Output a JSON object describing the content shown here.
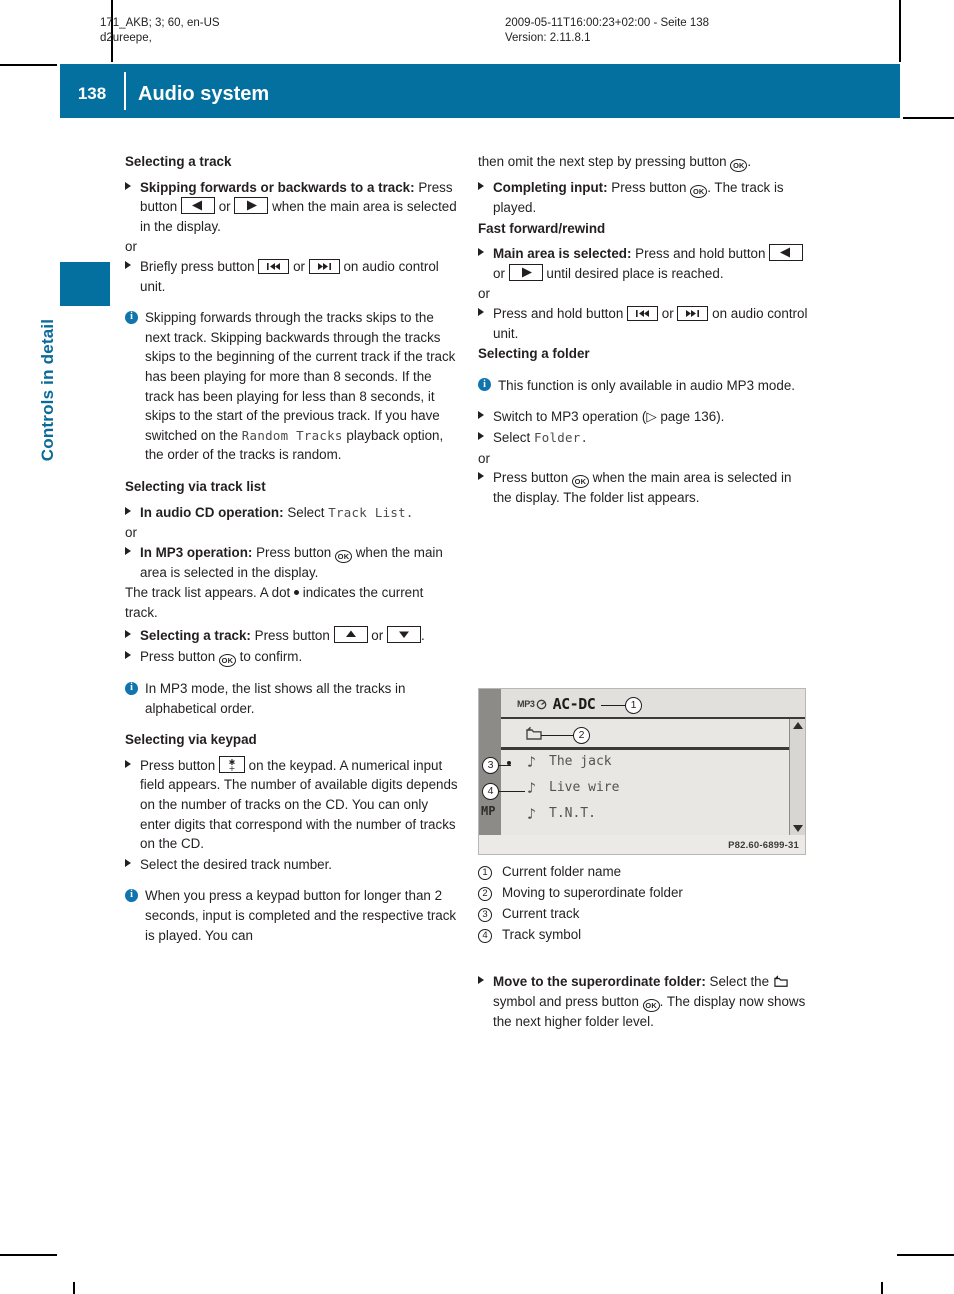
{
  "page": {
    "number": "138",
    "title": "Audio system",
    "side_tab_label": "Controls in detail",
    "accent_color": "#03709f",
    "info_icon_color": "#1074ad"
  },
  "meta": {
    "left_line1": "171_AKB; 3; 60, en-US",
    "left_line2": "d2ureepe,",
    "right_line1": "2009-05-11T16:00:23+02:00 - Seite 138",
    "right_line2": "Version: 2.11.8.1"
  },
  "left_column": {
    "heading_selecting_track": "Selecting a track",
    "skip_bold": "Skipping forwards or backwards to a track:",
    "skip_text_1": "Press button",
    "skip_or": "or",
    "skip_text_2": "when the main area is selected in the display.",
    "or_1": "or",
    "briefly_text_1": "Briefly press button",
    "briefly_or": "or",
    "briefly_text_2": "on audio control unit.",
    "note_1_part1": "Skipping forwards through the tracks skips to the next track. Skipping backwards through the tracks skips to the beginning of the current track if the track has been playing for more than 8 seconds. If the track has been playing for less than 8 seconds, it skips to the start of the previous track. If you have switched on the",
    "note_1_mono": "Random Tracks",
    "note_1_part2": "playback option, the order of the tracks is random.",
    "heading_track_list": "Selecting via track list",
    "cd_bold": "In audio CD operation:",
    "cd_text": "Select",
    "cd_mono": "Track List.",
    "or_2": "or",
    "mp3_bold": "In MP3 operation:",
    "mp3_text_1": "Press button",
    "mp3_text_2": "when the main area is selected in the display.",
    "tracklist_appears_1": "The track list appears. A dot",
    "tracklist_appears_2": "indicates the current track.",
    "sel_track_bold": "Selecting a track:",
    "sel_track_text_1": "Press button",
    "sel_track_or": "or",
    "sel_track_text_2": ".",
    "confirm_text_1": "Press button",
    "confirm_text_2": "to confirm.",
    "note_2": "In MP3 mode, the list shows all the tracks in alphabetical order.",
    "heading_keypad": "Selecting via keypad",
    "keypad_text_1": "Press button",
    "keypad_text_2": "on the keypad.",
    "keypad_body": "A numerical input field appears. The number of available digits depends on the number of tracks on the CD. You can only enter digits that correspond with the number of tracks on the CD.",
    "select_number": "Select the desired track number.",
    "note_3": "When you press a keypad button for longer than 2 seconds, input is completed and the respective track is played. You can"
  },
  "right_column": {
    "cont_text_1": "then omit the next step by pressing button",
    "cont_text_2": ".",
    "completing_bold": "Completing input:",
    "completing_text_1": "Press button",
    "completing_text_2": ".",
    "track_played": "The track is played.",
    "heading_fast": "Fast forward/rewind",
    "main_area_bold": "Main area is selected:",
    "main_area_text_1": "Press and hold button",
    "main_area_or": "or",
    "main_area_text_2": "until desired place is reached.",
    "or_1": "or",
    "hold_text_1": "Press and hold button",
    "hold_or": "or",
    "hold_text_2": "on audio control unit.",
    "heading_folder": "Selecting a folder",
    "note_folder": "This function is only available in audio MP3 mode.",
    "switch_text": "Switch to MP3 operation (▷ page 136).",
    "select_text": "Select",
    "select_mono": "Folder.",
    "or_2": "or",
    "press_text_1": "Press button",
    "press_text_2": "when the main area is selected in the display.",
    "folder_list_appears": "The folder list appears."
  },
  "figure": {
    "mp3_badge": "MP3",
    "folder_title": "AC-DC",
    "tracks": [
      "The jack",
      "Live wire",
      "T.N.T."
    ],
    "corner_label": "MP",
    "code": "P82.60-6899-31",
    "callouts": [
      "1",
      "2",
      "3",
      "4"
    ]
  },
  "legend": {
    "items": [
      {
        "num": "1",
        "label": "Current folder name"
      },
      {
        "num": "2",
        "label": "Moving to superordinate folder"
      },
      {
        "num": "3",
        "label": "Current track"
      },
      {
        "num": "4",
        "label": "Track symbol"
      }
    ]
  },
  "tail": {
    "move_bold": "Move to the superordinate folder:",
    "move_text_1": "Select the",
    "move_text_2": "symbol and press button",
    "move_text_3": ".",
    "move_text_4": "The display now shows the next higher folder level."
  },
  "glyphs": {
    "ok_label": "OK",
    "left_arrow": "left-arrow",
    "right_arrow": "right-arrow",
    "skip_back": "skip-back",
    "skip_fwd": "skip-forward",
    "up_arrow": "up-arrow",
    "down_arrow": "down-arrow",
    "star_plus": "star-plus-key",
    "up_folder": "up-folder",
    "note": "music-note"
  }
}
